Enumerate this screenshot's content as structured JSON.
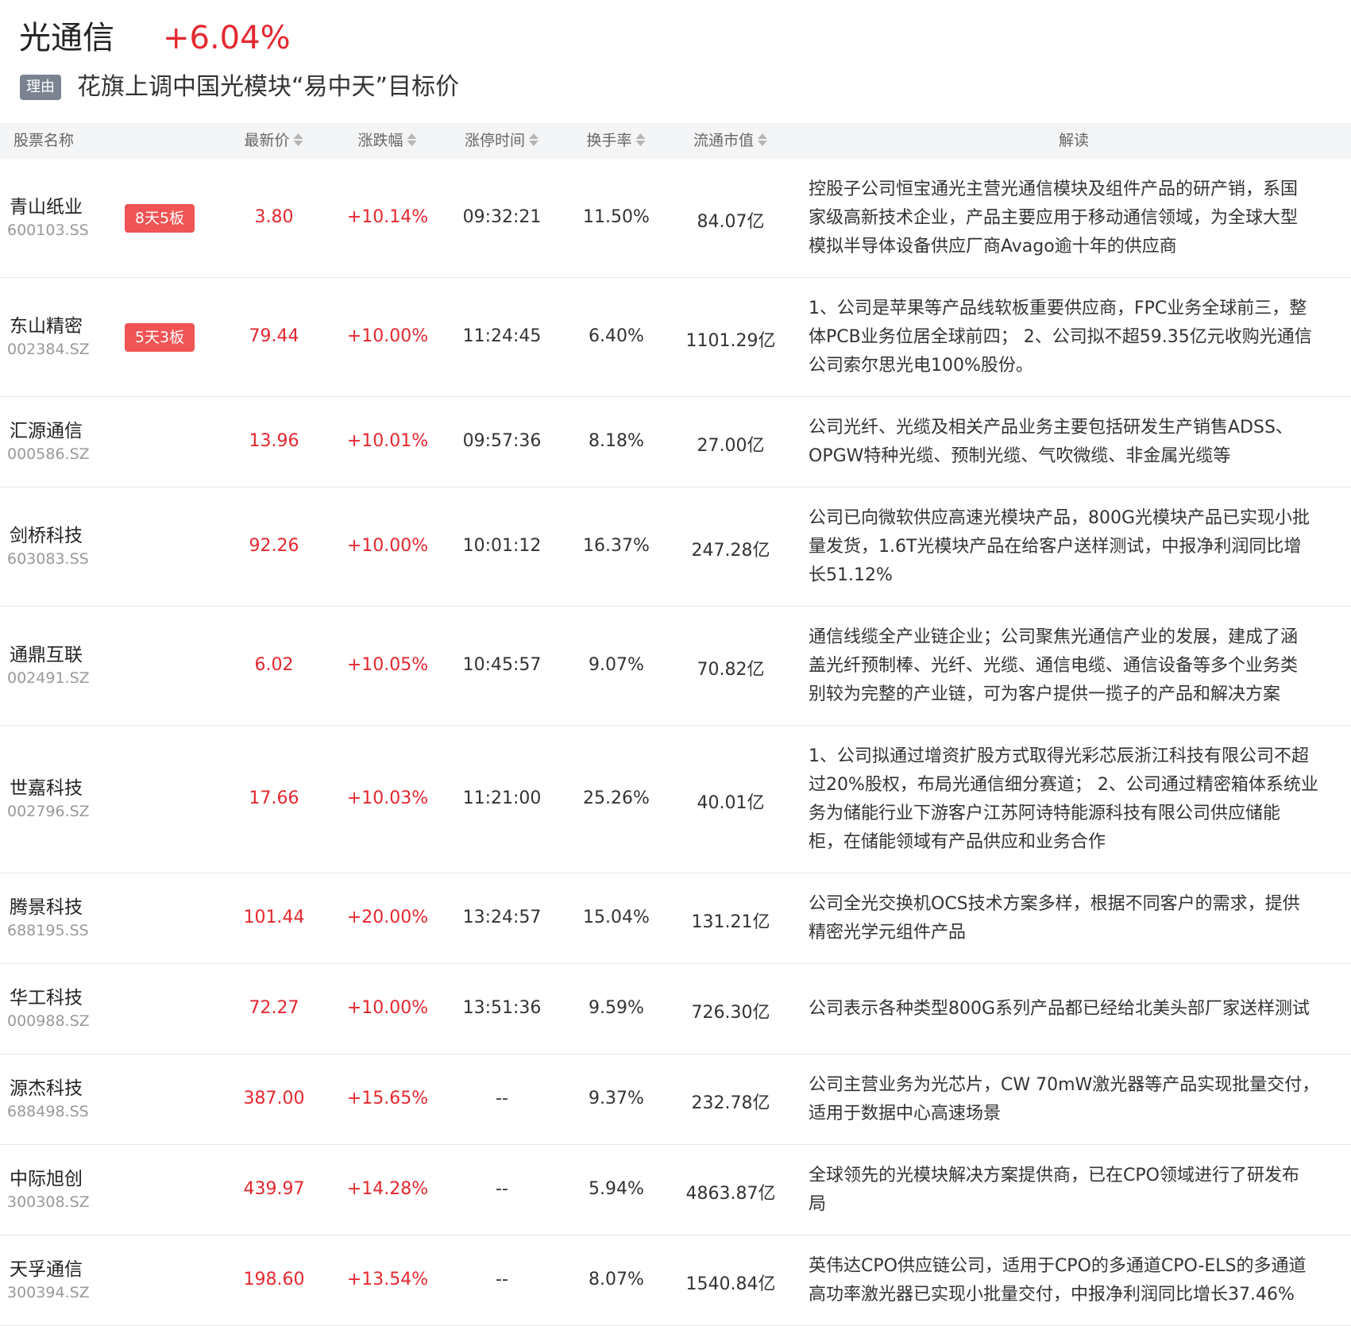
{
  "header": {
    "sector_name": "光通信",
    "sector_change": "+6.04%",
    "reason_tag": "理由",
    "reason_text": "花旗上调中国光模块“易中天”目标价"
  },
  "colors": {
    "up": "#e5282f",
    "badge": "#f05454",
    "reason_tag": "#7b8391",
    "header_bg": "#f4f5f7"
  },
  "table": {
    "columns": {
      "name": "股票名称",
      "price": "最新价",
      "change": "涨跌幅",
      "limit_time": "涨停时间",
      "turnover": "换手率",
      "float_cap": "流通市值",
      "analysis": "解读"
    },
    "sort_icon": "sort-updown-icon",
    "rows": [
      {
        "name": "青山纸业",
        "code": "600103.SS",
        "badge": "8天5板",
        "price": "3.80",
        "change": "+10.14%",
        "limit_time": "09:32:21",
        "turnover": "11.50%",
        "float_cap": "84.07亿",
        "lines": [
          "控股子公司恒宝通光主营光通信模块及组件产品的研产销，系国",
          "家级高新技术企业，产品主要应用于移动通信领域，为全球大型",
          "模拟半导体设备供应厂商Avago逾十年的供应商"
        ]
      },
      {
        "name": "东山精密",
        "code": "002384.SZ",
        "badge": "5天3板",
        "price": "79.44",
        "change": "+10.00%",
        "limit_time": "11:24:45",
        "turnover": "6.40%",
        "float_cap": "1101.29亿",
        "lines": [
          "1、公司是苹果等产品线软板重要供应商，FPC业务全球前三，整",
          "体PCB业务位居全球前四； 2、公司拟不超59.35亿元收购光通信",
          "公司索尔思光电100%股份。"
        ]
      },
      {
        "name": "汇源通信",
        "code": "000586.SZ",
        "badge": "",
        "price": "13.96",
        "change": "+10.01%",
        "limit_time": "09:57:36",
        "turnover": "8.18%",
        "float_cap": "27.00亿",
        "lines": [
          "公司光纤、光缆及相关产品业务主要包括研发生产销售ADSS、",
          "OPGW特种光缆、预制光缆、气吹微缆、非金属光缆等"
        ]
      },
      {
        "name": "剑桥科技",
        "code": "603083.SS",
        "badge": "",
        "price": "92.26",
        "change": "+10.00%",
        "limit_time": "10:01:12",
        "turnover": "16.37%",
        "float_cap": "247.28亿",
        "lines": [
          "公司已向微软供应高速光模块产品，800G光模块产品已实现小批",
          "量发货，1.6T光模块产品在给客户送样测试，中报净利润同比增",
          "长51.12%"
        ]
      },
      {
        "name": "通鼎互联",
        "code": "002491.SZ",
        "badge": "",
        "price": "6.02",
        "change": "+10.05%",
        "limit_time": "10:45:57",
        "turnover": "9.07%",
        "float_cap": "70.82亿",
        "lines": [
          "通信线缆全产业链企业；公司聚焦光通信产业的发展，建成了涵",
          "盖光纤预制棒、光纤、光缆、通信电缆、通信设备等多个业务类",
          "别较为完整的产业链，可为客户提供一揽子的产品和解决方案"
        ]
      },
      {
        "name": "世嘉科技",
        "code": "002796.SZ",
        "badge": "",
        "price": "17.66",
        "change": "+10.03%",
        "limit_time": "11:21:00",
        "turnover": "25.26%",
        "float_cap": "40.01亿",
        "lines": [
          "1、公司拟通过增资扩股方式取得光彩芯辰浙江科技有限公司不超",
          "过20%股权，布局光通信细分赛道； 2、公司通过精密箱体系统业",
          "务为储能行业下游客户江苏阿诗特能源科技有限公司供应储能",
          "柜，在储能领域有产品供应和业务合作"
        ]
      },
      {
        "name": "腾景科技",
        "code": "688195.SS",
        "badge": "",
        "price": "101.44",
        "change": "+20.00%",
        "limit_time": "13:24:57",
        "turnover": "15.04%",
        "float_cap": "131.21亿",
        "lines": [
          "公司全光交换机OCS技术方案多样，根据不同客户的需求，提供",
          "精密光学元组件产品"
        ]
      },
      {
        "name": "华工科技",
        "code": "000988.SZ",
        "badge": "",
        "price": "72.27",
        "change": "+10.00%",
        "limit_time": "13:51:36",
        "turnover": "9.59%",
        "float_cap": "726.30亿",
        "lines": [
          "公司表示各种类型800G系列产品都已经给北美头部厂家送样测试"
        ]
      },
      {
        "name": "源杰科技",
        "code": "688498.SS",
        "badge": "",
        "price": "387.00",
        "change": "+15.65%",
        "limit_time": "--",
        "turnover": "9.37%",
        "float_cap": "232.78亿",
        "lines": [
          "公司主营业务为光芯片，CW 70mW激光器等产品实现批量交付，",
          "适用于数据中心高速场景"
        ]
      },
      {
        "name": "中际旭创",
        "code": "300308.SZ",
        "badge": "",
        "price": "439.97",
        "change": "+14.28%",
        "limit_time": "--",
        "turnover": "5.94%",
        "float_cap": "4863.87亿",
        "lines": [
          "全球领先的光模块解决方案提供商，已在CPO领域进行了研发布",
          "局"
        ]
      },
      {
        "name": "天孚通信",
        "code": "300394.SZ",
        "badge": "",
        "price": "198.60",
        "change": "+13.54%",
        "limit_time": "--",
        "turnover": "8.07%",
        "float_cap": "1540.84亿",
        "lines": [
          "英伟达CPO供应链公司，适用于CPO的多通道CPO-ELS的多通道",
          "高功率激光器已实现小批量交付，中报净利润同比增长37.46%"
        ]
      }
    ]
  }
}
